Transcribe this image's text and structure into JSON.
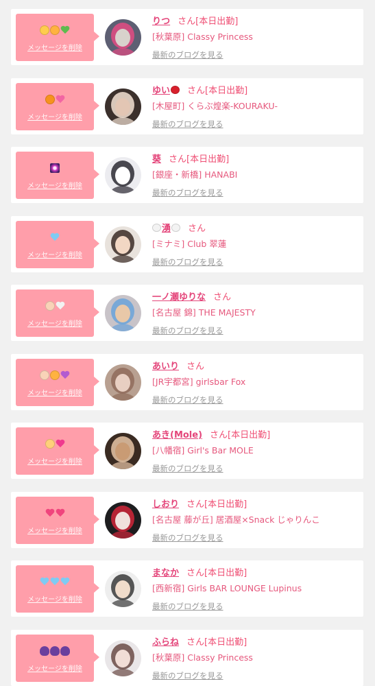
{
  "cards": [
    {
      "icons": [
        "pleading-face-icon",
        "bell-icon",
        "green-heart-icon"
      ],
      "delete_label": "メッセージを削除",
      "name": "りつ",
      "name_suffix_icons": [],
      "honorific": "さん",
      "status": "[本日出勤]",
      "shop": "[秋葉原] Classy Princess",
      "blog_link": "最新のブログを見る",
      "avatar": {
        "bg": "#5d5f73",
        "fg": "#d8d2cc",
        "accent": "#e34b83"
      }
    },
    {
      "icons": [
        "jack-o-lantern-icon",
        "sparkling-heart-icon"
      ],
      "delete_label": "メッセージを削除",
      "name": "ゆい",
      "name_suffix_icons": [
        "cherries-icon"
      ],
      "honorific": "さん",
      "status": "[本日出勤]",
      "shop": "[木屋町] くらぶ煌楽-KOURAKU-",
      "blog_link": "最新のブログを見る",
      "avatar": {
        "bg": "#3b302c",
        "fg": "#e3c6b4",
        "accent": "#f4e2d4"
      }
    },
    {
      "icons": [
        "sparkle-icon"
      ],
      "delete_label": "メッセージを削除",
      "name": "葵",
      "name_suffix_icons": [],
      "honorific": "さん",
      "status": "[本日出勤]",
      "shop": "[銀座・新橋] HANABI",
      "blog_link": "最新のブログを見る",
      "avatar": {
        "bg": "#ececf0",
        "fg": "#ffffff",
        "accent": "#2d2b33"
      }
    },
    {
      "icons": [
        "light-blue-heart-icon"
      ],
      "delete_label": "メッセージを削除",
      "name": "湧",
      "name_prefix_icons": [
        "rice-ball-icon"
      ],
      "name_suffix_icons": [
        "rice-ball-icon"
      ],
      "honorific": "さん",
      "status": "",
      "shop": "[ミナミ] Club 翠蓮",
      "blog_link": "最新のブログを見る",
      "avatar": {
        "bg": "#e8e2dc",
        "fg": "#f2d7c4",
        "accent": "#3b2c26"
      }
    },
    {
      "icons": [
        "baby-icon",
        "white-heart-icon"
      ],
      "delete_label": "メッセージを削除",
      "name": "一ノ瀬ゆりな",
      "name_suffix_icons": [],
      "honorific": "さん",
      "status": "",
      "shop": "[名古屋 錦] THE MAJESTY",
      "blog_link": "最新のブログを見る",
      "avatar": {
        "bg": "#c8c3c8",
        "fg": "#e8c8a8",
        "accent": "#6aa3d9"
      }
    },
    {
      "icons": [
        "baby-icon",
        "bell-icon",
        "purple-heart-icon"
      ],
      "delete_label": "メッセージを削除",
      "name": "あいり",
      "name_suffix_icons": [],
      "honorific": "さん",
      "status": "",
      "shop": "[JR宇都宮] girlsbar Fox",
      "blog_link": "最新のブログを見る",
      "avatar": {
        "bg": "#b8a091",
        "fg": "#e8cfc2",
        "accent": "#8f6b5a"
      }
    },
    {
      "icons": [
        "baby-angel-icon",
        "pink-heart-icon"
      ],
      "delete_label": "メッセージを削除",
      "name": "あき(Mole)",
      "name_suffix_icons": [],
      "honorific": "さん",
      "status": "[本日出勤]",
      "shop": "[八幡宿] Girl's Bar MOLE",
      "blog_link": "最新のブログを見る",
      "avatar": {
        "bg": "#3a2b22",
        "fg": "#c99b74",
        "accent": "#e8c6a6"
      }
    },
    {
      "icons": [
        "heart-with-arrow-icon",
        "heart-with-arrow-icon"
      ],
      "delete_label": "メッセージを削除",
      "name": "しおり",
      "name_suffix_icons": [],
      "honorific": "さん",
      "status": "[本日出勤]",
      "shop": "[名古屋 藤が丘] 居酒屋×Snack じゃりんこ",
      "blog_link": "最新のブログを見る",
      "avatar": {
        "bg": "#1d1d1f",
        "fg": "#f0e0dc",
        "accent": "#d0263a"
      }
    },
    {
      "icons": [
        "light-blue-heart-icon",
        "light-blue-heart-icon",
        "light-blue-heart-icon"
      ],
      "delete_label": "メッセージを削除",
      "name": "まなか",
      "name_suffix_icons": [],
      "honorific": "さん",
      "status": "[本日出勤]",
      "shop": "[西新宿] Girls BAR LOUNGE Lupinus",
      "blog_link": "最新のブログを見る",
      "avatar": {
        "bg": "#eeeeee",
        "fg": "#f0dccb",
        "accent": "#3a3a3a"
      }
    },
    {
      "icons": [
        "alien-monster-icon",
        "alien-monster-icon",
        "alien-monster-icon"
      ],
      "delete_label": "メッセージを削除",
      "name": "ふらね",
      "name_suffix_icons": [],
      "honorific": "さん",
      "status": "[本日出勤]",
      "shop": "[秋葉原] Classy Princess",
      "blog_link": "最新のブログを見る",
      "avatar": {
        "bg": "#e9e6e8",
        "fg": "#f1ddd6",
        "accent": "#6b4b47"
      }
    }
  ],
  "colors": {
    "bubble": "#ff9eaa",
    "name": "#e4457a",
    "text_pink": "#ef4f74",
    "link_grey": "#999999",
    "page_bg": "#f1f1f1"
  }
}
